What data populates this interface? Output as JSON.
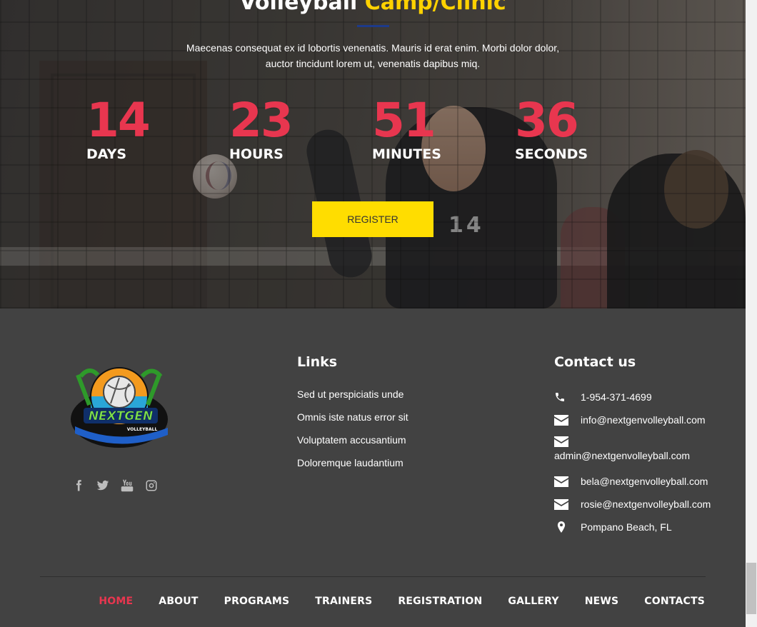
{
  "hero": {
    "title_main": "Volleyball ",
    "title_accent": "Camp/Clinic",
    "description": "Maecenas consequat ex id lobortis venenatis. Mauris id erat enim. Morbi dolor dolor, auctor tincidunt lorem ut, venenatis dapibus miq.",
    "countdown": [
      {
        "value": "14",
        "label": "DAYS"
      },
      {
        "value": "23",
        "label": "HOURS"
      },
      {
        "value": "51",
        "label": "MINUTES"
      },
      {
        "value": "36",
        "label": "SECONDS"
      }
    ],
    "register_label": "REGISTER",
    "jersey_number": "14"
  },
  "footer": {
    "logo_text_1": "NEXTGEN",
    "logo_text_2": "VOLLEYBALL",
    "socials": [
      "facebook-icon",
      "twitter-icon",
      "youtube-icon",
      "instagram-icon"
    ],
    "links_title": "Links",
    "links": [
      "Sed ut perspiciatis unde",
      "Omnis iste natus error sit",
      "Voluptatem accusantium",
      "Doloremque laudantium"
    ],
    "contact_title": "Contact us",
    "contact": {
      "phone": "1-954-371-4699",
      "emails": [
        "info@nextgenvolleyball.com",
        "admin@nextgenvolleyball.com",
        "bela@nextgenvolleyball.com",
        "rosie@nextgenvolleyball.com"
      ],
      "location": "Pompano Beach, FL"
    },
    "nav": [
      "HOME",
      "ABOUT",
      "PROGRAMS",
      "TRAINERS",
      "REGISTRATION",
      "GALLERY",
      "NEWS",
      "CONTACTS"
    ]
  },
  "colors": {
    "accent_red": "#e8364f",
    "accent_yellow": "#ffdd00",
    "footer_bg": "#424242"
  }
}
